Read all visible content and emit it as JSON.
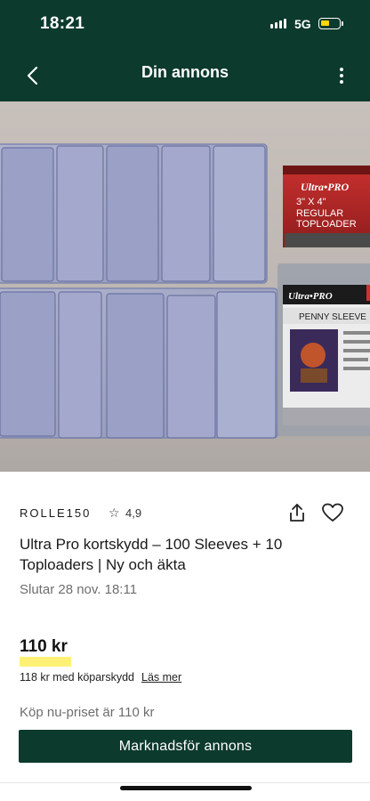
{
  "status": {
    "time": "18:21",
    "network": "5G"
  },
  "header": {
    "title": "Din annons"
  },
  "product_image": {
    "box1_brand": "Ultra•PRO",
    "box1_line1": "3\" X 4\"",
    "box1_line2": "REGULAR",
    "box1_line3": "TOPLOADER",
    "box2_brand": "Ultra•PRO",
    "box2_label": "PENNY SLEEVE"
  },
  "listing": {
    "seller": "ROLLE150",
    "rating": "4,9",
    "title": "Ultra Pro kortskydd – 100 Sleeves + 10 Toploaders | Ny och äkta",
    "ends": "Slutar 28 nov. 18:11",
    "price": "110 kr",
    "buyer_protection": "118 kr med köparskydd",
    "read_more": "Läs mer",
    "buy_now": "Köp nu-priset är 110 kr",
    "cta": "Marknadsför annons"
  },
  "colors": {
    "brand": "#0c3a2c",
    "highlight": "#fff176",
    "battery": "#ffd60a"
  }
}
